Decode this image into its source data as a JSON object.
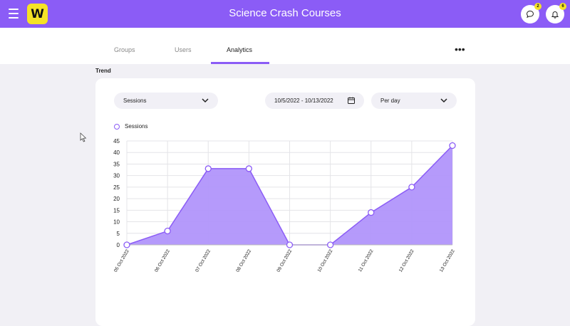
{
  "header": {
    "title": "Science Crash Courses",
    "logo_letter": "W",
    "chat_badge": "2",
    "notif_badge": "6"
  },
  "tabs": [
    {
      "label": "Groups"
    },
    {
      "label": "Users"
    },
    {
      "label": "Analytics"
    }
  ],
  "more_label": "•••",
  "section": {
    "title": "Trend"
  },
  "controls": {
    "metric": "Sessions",
    "date_range": "10/5/2022 - 10/13/2022",
    "interval": "Per day"
  },
  "colors": {
    "accent": "#8b5cf6",
    "area": "#b195fb",
    "logo": "#f5e326"
  },
  "chart_data": {
    "type": "area",
    "x": [
      "05 Oct 2022",
      "06 Oct 2022",
      "07 Oct 2022",
      "08 Oct 2022",
      "09 Oct 2022",
      "10 Oct 2022",
      "11 Oct 2022",
      "12 Oct 2022",
      "13 Oct 2022"
    ],
    "series": [
      {
        "name": "Sessions",
        "values": [
          0,
          6,
          33,
          33,
          0,
          0,
          14,
          25,
          43
        ]
      }
    ],
    "ylim": [
      0,
      45
    ],
    "yticks": [
      0,
      5,
      10,
      15,
      20,
      25,
      30,
      35,
      40,
      45
    ],
    "grid": true,
    "legend": "top-left"
  }
}
